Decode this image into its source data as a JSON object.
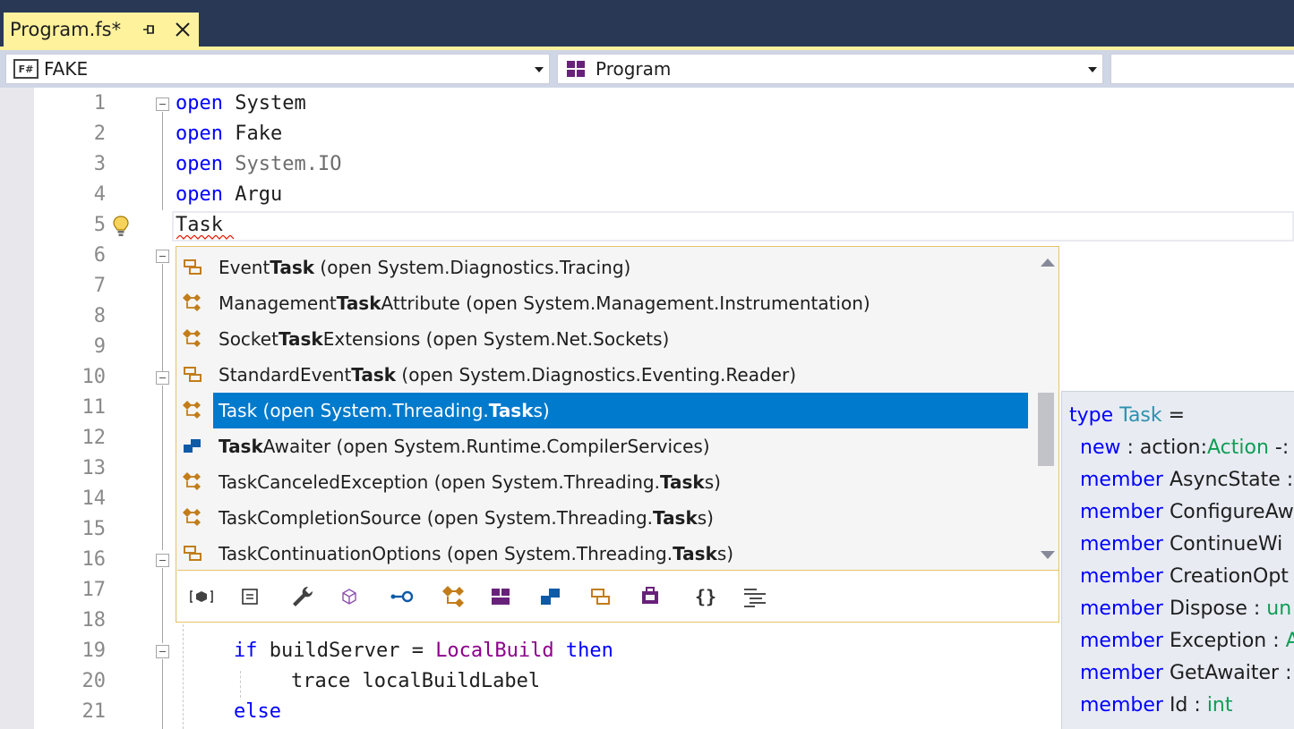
{
  "tab": {
    "title": "Program.fs*"
  },
  "navbar": {
    "project_icon": "F#",
    "project": "FAKE",
    "namespace": "Program"
  },
  "lines": [
    {
      "n": "1"
    },
    {
      "n": "2"
    },
    {
      "n": "3"
    },
    {
      "n": "4"
    },
    {
      "n": "5"
    },
    {
      "n": "6"
    },
    {
      "n": "7"
    },
    {
      "n": "8"
    },
    {
      "n": "9"
    },
    {
      "n": "10"
    },
    {
      "n": "11"
    },
    {
      "n": "12"
    },
    {
      "n": "13"
    },
    {
      "n": "14"
    },
    {
      "n": "15"
    },
    {
      "n": "16"
    },
    {
      "n": "17"
    },
    {
      "n": "18"
    },
    {
      "n": "19"
    },
    {
      "n": "20"
    },
    {
      "n": "21"
    }
  ],
  "code": {
    "l1_kw": "open",
    "l1_rest": "System",
    "l2_kw": "open",
    "l2_rest": "Fake",
    "l3_kw": "open",
    "l3_rest": "System.IO",
    "l4_kw": "open",
    "l4_rest": "Argu",
    "l5": "Task",
    "l19_kw1": "if",
    "l19_mid": "buildServer =",
    "l19_val": "LocalBuild",
    "l19_kw2": "then",
    "l20": "trace localBuildLabel",
    "l21_kw": "else"
  },
  "completion": {
    "items": [
      {
        "pre": "Event",
        "bold": "Task",
        "post": " (open System.Diagnostics.Tracing)",
        "icon": "event-class-icon"
      },
      {
        "pre": "Management",
        "bold": "Task",
        "post": "Attribute (open System.Management.Instrumentation)",
        "icon": "class-icon"
      },
      {
        "pre": "Socket",
        "bold": "Task",
        "post": "Extensions (open System.Net.Sockets)",
        "icon": "class-icon"
      },
      {
        "pre": "StandardEvent",
        "bold": "Task",
        "post": " (open System.Diagnostics.Eventing.Reader)",
        "icon": "event-class-icon"
      },
      {
        "pre": "Task (open System.Threading.",
        "bold": "Task",
        "post": "s)",
        "icon": "class-icon",
        "selected": true
      },
      {
        "pre": "",
        "bold": "Task",
        "post": "Awaiter (open System.Runtime.CompilerServices)",
        "icon": "struct-icon"
      },
      {
        "pre": "TaskCanceledException (open System.Threading.",
        "bold": "Task",
        "post": "s)",
        "icon": "class-icon"
      },
      {
        "pre": "TaskCompletionSource (open System.Threading.",
        "bold": "Task",
        "post": "s)",
        "icon": "class-icon"
      },
      {
        "pre": "TaskContinuationOptions (open System.Threading.",
        "bold": "Task",
        "post": "s)",
        "icon": "enum-icon"
      }
    ],
    "filters": [
      "snippet-icon",
      "property-icon",
      "wrench-icon",
      "cube-icon",
      "interface-icon",
      "class-icon",
      "module-icon",
      "struct-icon",
      "enum-icon",
      "delegate-icon",
      "namespace-icon",
      "keyword-icon"
    ]
  },
  "quickinfo": {
    "l1_kw": "type",
    "l1_name": "Task",
    "l1_rest": " =",
    "l2_kw": "new",
    "l2_mid": " : action:",
    "l2_type": "Action",
    "l2_rest": " -:",
    "l3_kw": "member",
    "l3_rest": " AsyncState :",
    "l4_kw": "member",
    "l4_rest": " ConfigureAw",
    "l5_kw": "member",
    "l5_rest": " ContinueWi",
    "l6_kw": "member",
    "l6_rest": " CreationOpt",
    "l7_kw": "member",
    "l7_rest": " Dispose : ",
    "l7_type": "un",
    "l8_kw": "member",
    "l8_rest": " Exception : ",
    "l8_type": "A",
    "l9_kw": "member",
    "l9_rest": " GetAwaiter :",
    "l10_kw": "member",
    "l10_rest": " Id : ",
    "l10_type": "int"
  },
  "colors": {
    "keyword": "#0000ff",
    "type": "#2b91af",
    "selection": "#007acc",
    "tab_accent": "#fff29d"
  }
}
